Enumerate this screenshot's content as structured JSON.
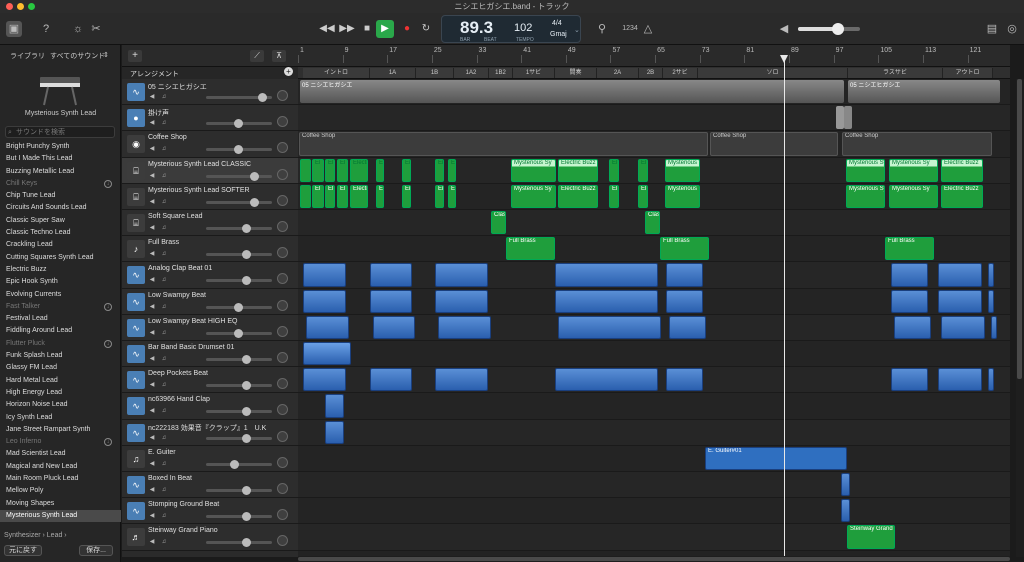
{
  "window": {
    "title": "ニシエヒガシエ.band - トラック"
  },
  "toolbar": {
    "lcd": {
      "bar": "89.3",
      "bar_label": "BAR",
      "beat_label": "BEAT",
      "tempo": "102",
      "tempo_label": "TEMPO",
      "signature": "4/4",
      "key": "Gmaj"
    },
    "count_in": "1234"
  },
  "library": {
    "tab_label": "ライブラリ",
    "sound_menu": "すべてのサウンド",
    "preview_name": "Mysterious Synth Lead",
    "search_placeholder": "サウンドを検索",
    "items": [
      {
        "label": "Bright Punchy Synth",
        "type": "item"
      },
      {
        "label": "But I Made This Lead",
        "type": "item"
      },
      {
        "label": "Buzzing Metallic Lead",
        "type": "item"
      },
      {
        "label": "Chill Keys",
        "type": "cat"
      },
      {
        "label": "Chip Tune Lead",
        "type": "item"
      },
      {
        "label": "Circuits And Sounds Lead",
        "type": "item"
      },
      {
        "label": "Classic Super Saw",
        "type": "item"
      },
      {
        "label": "Classic Techno Lead",
        "type": "item"
      },
      {
        "label": "Crackling Lead",
        "type": "item"
      },
      {
        "label": "Cutting Squares Synth Lead",
        "type": "item"
      },
      {
        "label": "Electric Buzz",
        "type": "item"
      },
      {
        "label": "Epic Hook Synth",
        "type": "item"
      },
      {
        "label": "Evolving Currents",
        "type": "item"
      },
      {
        "label": "Fast Talker",
        "type": "cat"
      },
      {
        "label": "Festival Lead",
        "type": "item"
      },
      {
        "label": "Fiddling Around Lead",
        "type": "item"
      },
      {
        "label": "Flutter Pluck",
        "type": "cat"
      },
      {
        "label": "Funk Splash Lead",
        "type": "item"
      },
      {
        "label": "Glassy FM Lead",
        "type": "item"
      },
      {
        "label": "Hard Metal Lead",
        "type": "item"
      },
      {
        "label": "High Energy Lead",
        "type": "item"
      },
      {
        "label": "Horizon Noise Lead",
        "type": "item"
      },
      {
        "label": "Icy Synth Lead",
        "type": "item"
      },
      {
        "label": "Jane Street Rampart Synth",
        "type": "item"
      },
      {
        "label": "Leo Inferno",
        "type": "cat"
      },
      {
        "label": "Mad Scientist Lead",
        "type": "item"
      },
      {
        "label": "Magical and New Lead",
        "type": "item"
      },
      {
        "label": "Main Room Pluck Lead",
        "type": "item"
      },
      {
        "label": "Mellow Poly",
        "type": "item"
      },
      {
        "label": "Moving Shapes",
        "type": "item"
      },
      {
        "label": "Mysterious Synth Lead",
        "type": "sel"
      }
    ],
    "breadcrumb": "Synthesizer  ›  Lead  ›",
    "revert_button": "元に戻す",
    "save_button": "保存..."
  },
  "arrangement": {
    "header_label": "アレンジメント",
    "sections": [
      {
        "label": "イントロ"
      },
      {
        "label": "1A"
      },
      {
        "label": "1B"
      },
      {
        "label": "1A2"
      },
      {
        "label": "1B2"
      },
      {
        "label": "1サビ"
      },
      {
        "label": "間奏"
      },
      {
        "label": "2A"
      },
      {
        "label": "2B"
      },
      {
        "label": "2サビ"
      },
      {
        "label": "ソロ"
      },
      {
        "label": "ラスサビ"
      },
      {
        "label": "アウトロ"
      }
    ],
    "ruler": [
      "1",
      "9",
      "17",
      "25",
      "33",
      "41",
      "49",
      "57",
      "65",
      "73",
      "81",
      "89",
      "97",
      "105",
      "113",
      "121"
    ]
  },
  "tracks": [
    {
      "name": "05 ニシエヒガシエ",
      "icon": "waveform-icon",
      "color": "#4a7fb5"
    },
    {
      "name": "掛け声",
      "icon": "person-icon",
      "color": "#4a7fb5"
    },
    {
      "name": "Coffee Shop",
      "icon": "drum-icon",
      "color": "#3c3c3c"
    },
    {
      "name": "Mysterious Synth Lead CLASSIC",
      "icon": "synth-icon",
      "color": "#3c3c3c"
    },
    {
      "name": "Mysterious Synth Lead SOFTER",
      "icon": "synth-icon",
      "color": "#3c3c3c"
    },
    {
      "name": "Soft Square Lead",
      "icon": "synth-icon",
      "color": "#3c3c3c"
    },
    {
      "name": "Full Brass",
      "icon": "brass-icon",
      "color": "#3c3c3c"
    },
    {
      "name": "Analog Clap Beat 01",
      "icon": "waveform-icon",
      "color": "#4a7fb5"
    },
    {
      "name": "Low Swampy Beat",
      "icon": "waveform-icon",
      "color": "#4a7fb5"
    },
    {
      "name": "Low Swampy Beat HIGH EQ",
      "icon": "waveform-icon",
      "color": "#4a7fb5"
    },
    {
      "name": "Bar Band Basic Drumset 01",
      "icon": "waveform-icon",
      "color": "#4a7fb5"
    },
    {
      "name": "Deep Pockets Beat",
      "icon": "waveform-icon",
      "color": "#4a7fb5"
    },
    {
      "name": "nc63966 Hand Clap",
      "icon": "waveform-icon",
      "color": "#4a7fb5"
    },
    {
      "name": "nc222183 効果音『クラップ』1　U.K",
      "icon": "waveform-icon",
      "color": "#4a7fb5"
    },
    {
      "name": "E. Guiter",
      "icon": "guitar-icon",
      "color": "#3c3c3c"
    },
    {
      "name": "Boxed In Beat",
      "icon": "waveform-icon",
      "color": "#4a7fb5"
    },
    {
      "name": "Stomping Ground Beat",
      "icon": "waveform-icon",
      "color": "#4a7fb5"
    },
    {
      "name": "Steinway Grand Piano",
      "icon": "piano-icon",
      "color": "#3c3c3c"
    }
  ],
  "regions": {
    "main_audio": "05 ニシエヒガシエ",
    "coffee": "Coffee Shop",
    "classic_label": "Mysterious Sy",
    "buzz_label": "Electric Buzz",
    "mysterious_label": "Mysterious",
    "el_label": "El",
    "electri_label": "Electri",
    "clas_label": "Clas",
    "brass_label": "Full Brass",
    "guitar_label": "E. Guiter#01",
    "steinway_label": "Steinway Grand"
  }
}
